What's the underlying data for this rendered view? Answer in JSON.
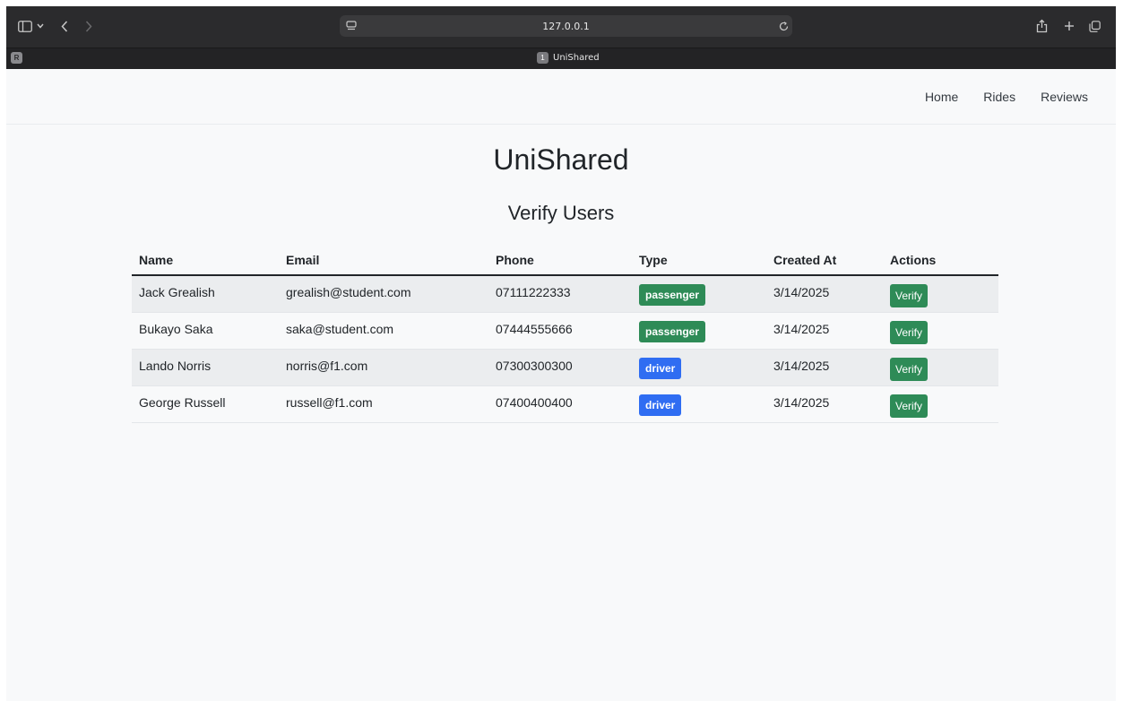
{
  "browser": {
    "url": "127.0.0.1",
    "tab_badge": "R",
    "tab_number": "1",
    "tab_title": "UniShared"
  },
  "nav": {
    "links": [
      "Home",
      "Rides",
      "Reviews"
    ]
  },
  "page": {
    "title": "UniShared",
    "subtitle": "Verify Users"
  },
  "table": {
    "headers": [
      "Name",
      "Email",
      "Phone",
      "Type",
      "Created At",
      "Actions"
    ],
    "rows": [
      {
        "name": "Jack Grealish",
        "email": "grealish@student.com",
        "phone": "07111222333",
        "type": "passenger",
        "created_at": "3/14/2025",
        "action": "Verify"
      },
      {
        "name": "Bukayo Saka",
        "email": "saka@student.com",
        "phone": "07444555666",
        "type": "passenger",
        "created_at": "3/14/2025",
        "action": "Verify"
      },
      {
        "name": "Lando Norris",
        "email": "norris@f1.com",
        "phone": "07300300300",
        "type": "driver",
        "created_at": "3/14/2025",
        "action": "Verify"
      },
      {
        "name": "George Russell",
        "email": "russell@f1.com",
        "phone": "07400400400",
        "type": "driver",
        "created_at": "3/14/2025",
        "action": "Verify"
      }
    ]
  },
  "colors": {
    "passenger": "#2e8b57",
    "driver": "#2f6df2",
    "verify": "#2e8b57"
  },
  "icons": {
    "sidebar": "sidebar-icon",
    "back": "chevron-left-icon",
    "forward": "chevron-right-icon",
    "site": "site-settings-icon",
    "reload": "reload-icon",
    "share": "share-icon",
    "new_tab": "plus-icon",
    "tabs": "tab-overview-icon"
  }
}
